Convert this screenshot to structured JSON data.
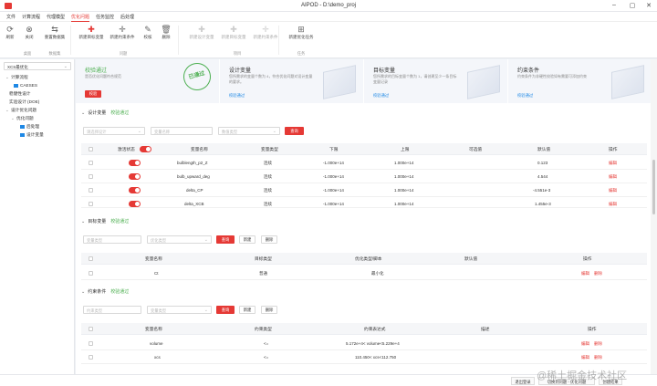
{
  "window": {
    "title": "AIPOD - D:\\demo_proj"
  },
  "menu": [
    "文件",
    "计算流程",
    "代理模型",
    "优化问题",
    "任务监控",
    "后处理"
  ],
  "ribbon": {
    "buttons": [
      "刷新",
      "关闭",
      "重置数据集",
      "新建目标变量",
      "新建约束条件",
      "校核",
      "删除",
      "新建设计变量",
      "新建目标变量",
      "新建约束条件",
      "新建优化任务"
    ],
    "groups": [
      "桌面",
      "数据集",
      "问题",
      "项目",
      "任务"
    ]
  },
  "sidebar": {
    "select": "XCS最优化",
    "tree": [
      "计算流程",
      "CAESES",
      "稳健性设计",
      "实验设计 (DOE)",
      "设计优化问题",
      "优化问题",
      "后处理",
      "设计变量"
    ]
  },
  "cards": [
    {
      "title": "校验通过",
      "desc": "是否优化问题符合规范",
      "btn": "校验",
      "stamp": "已通过"
    },
    {
      "title": "设计变量",
      "desc": "您所需求的变量个数为 4，符合优化问题对设计变量的要求。",
      "link": "校验通过"
    },
    {
      "title": "目标变量",
      "desc": "您所需求的目标变量个数为 1，请创建至少一条目标变量记录",
      "link": "校验通过"
    },
    {
      "title": "约束条件",
      "desc": "约束条件为非硬性校验如有需要可添加约束",
      "link": "校验通过"
    }
  ],
  "design": {
    "head": "设计变量",
    "ok": "校验通过",
    "filters": [
      "请选择设计",
      "变量名称",
      "数值类型"
    ],
    "query": "查询",
    "columns": [
      "激活状态",
      "变量名称",
      "变量类型",
      "下限",
      "上限",
      "可选值",
      "默认值",
      "操作"
    ],
    "rows": [
      {
        "name": "bulblength_p2_Z",
        "type": "连续",
        "lower": "-1.000e+14",
        "upper": "1.000e+14",
        "opt": "",
        "def": "0.123",
        "op": "编辑"
      },
      {
        "name": "bulb_upward_deg",
        "type": "连续",
        "lower": "-1.000e+14",
        "upper": "1.000e+14",
        "opt": "",
        "def": "4.544",
        "op": "编辑"
      },
      {
        "name": "delta_CP",
        "type": "连续",
        "lower": "-1.000e+14",
        "upper": "1.000e+14",
        "opt": "",
        "def": "-4.551e-3",
        "op": "编辑"
      },
      {
        "name": "delta_XCB",
        "type": "连续",
        "lower": "-1.000e+14",
        "upper": "1.000e+14",
        "opt": "",
        "def": "1.455e-3",
        "op": "编辑"
      }
    ]
  },
  "objective": {
    "head": "目标变量",
    "ok": "校验通过",
    "filters": [
      "变量类型",
      "优化类型"
    ],
    "query": "查询",
    "add": "新建",
    "del": "删除",
    "columns": [
      "变量名称",
      "目标类型",
      "优化类型/脚本",
      "默认值",
      "操作"
    ],
    "rows": [
      {
        "name": "Ct",
        "type": "普通",
        "opt": "最小化",
        "def": "",
        "edit": "编辑",
        "del": "删除"
      }
    ]
  },
  "constraint": {
    "head": "约束条件",
    "ok": "校验通过",
    "filters": [
      "约束类型",
      "变量类型"
    ],
    "query": "查询",
    "add": "新建",
    "del": "删除",
    "columns": [
      "变量名称",
      "约束类型",
      "约束表达式",
      "描述",
      "操作"
    ],
    "rows": [
      {
        "name": "volume",
        "type": "<=",
        "expr": "5.172e+4< volume<5.229e+4",
        "desc": "",
        "edit": "编辑",
        "del": "删除"
      },
      {
        "name": "xcs",
        "type": "<=",
        "expr": "110.450< xcs<112.750",
        "desc": "",
        "edit": "编辑",
        "del": "删除"
      }
    ]
  },
  "status": {
    "btns": [
      "退出登录",
      "切换到问题 - 优化问题",
      "创建结果"
    ]
  },
  "watermark": "@稀土掘金技术社区"
}
